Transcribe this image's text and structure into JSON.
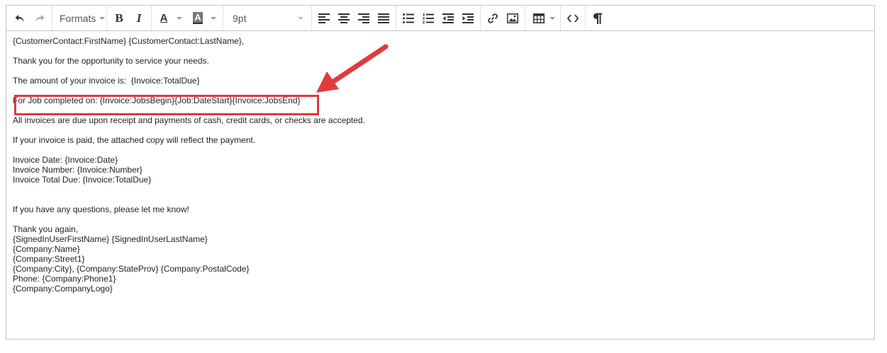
{
  "toolbar": {
    "formats_label": "Formats",
    "bold_label": "B",
    "italic_label": "I",
    "text_color_label": "A",
    "bg_color_label": "A",
    "font_size": "9pt"
  },
  "content": {
    "greeting": "{CustomerContact:FirstName} {CustomerContact:LastName},",
    "thanks": "Thank you for the opportunity to service your needs.",
    "amount": "The amount of your invoice is:  {Invoice:TotalDue}",
    "job_completed": "For Job completed on: {Invoice:JobsBegin}{Job:DateStart}{Invoice:JobsEnd}",
    "due": "All invoices are due upon receipt and payments of cash, credit cards, or checks are accepted.",
    "paid": "If your invoice is paid, the attached copy will reflect the payment.",
    "invoice_date": "Invoice Date: {Invoice:Date}",
    "invoice_number": "Invoice Number: {Invoice:Number}",
    "invoice_total": "Invoice Total Due: {Invoice:TotalDue}",
    "questions": "If you have any questions, please let me know!",
    "thank_again": "Thank you again,",
    "signed_user": "{SignedInUserFirstName} {SignedInUserLastName}",
    "company_name": "{Company:Name}",
    "company_street": "{Company:Street1}",
    "company_city": "{Company:City}, {Company:StateProv} {Company:PostalCode}",
    "phone": "Phone: {Company:Phone1}",
    "logo": "{Company:CompanyLogo}"
  },
  "colors": {
    "highlight": "#e03a3e",
    "border": "#c5c5c5",
    "icon": "#333333"
  }
}
